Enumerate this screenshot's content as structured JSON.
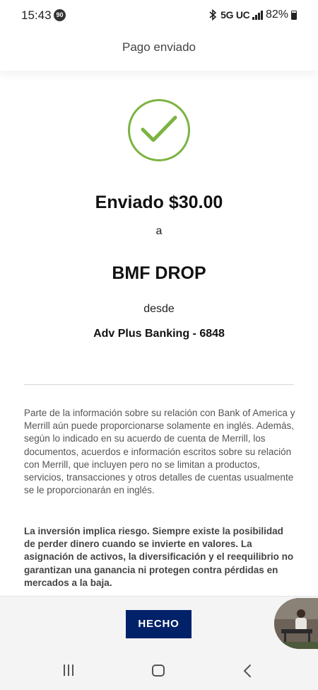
{
  "status_bar": {
    "time": "15:43",
    "notification_count": "90",
    "network": "5G UC",
    "battery": "82%"
  },
  "header": {
    "title": "Pago enviado"
  },
  "confirmation": {
    "icon": "check-circle-icon",
    "accent_color": "#7cb342",
    "sent_label": "Enviado $30.00",
    "to_word": "a",
    "recipient": "BMF DROP",
    "from_word": "desde",
    "account": "Adv Plus Banking - 6848"
  },
  "disclaimer": {
    "info_text": "Parte de la información sobre su relación con Bank of America y Merrill aún puede proporcionarse solamente en inglés. Además, según lo indicado en su acuerdo de cuenta de Merrill, los documentos, acuerdos e información escritos sobre su relación con Merrill, que incluyen pero no se limitan a productos, servicios, transacciones y otros detalles de cuentas usualmente se le proporcionarán en inglés.",
    "risk_text": "La inversión implica riesgo. Siempre existe la posibilidad de perder dinero cuando se invierte en valores. La asignación de activos, la diversificación y el reequilibrio no garantizan una ganancia ni protegen contra pérdidas en mercados a la baja."
  },
  "footer": {
    "done_label": "HECHO",
    "button_color": "#012169"
  },
  "nav": {
    "recents": "recents-icon",
    "home": "home-icon",
    "back": "back-icon"
  }
}
